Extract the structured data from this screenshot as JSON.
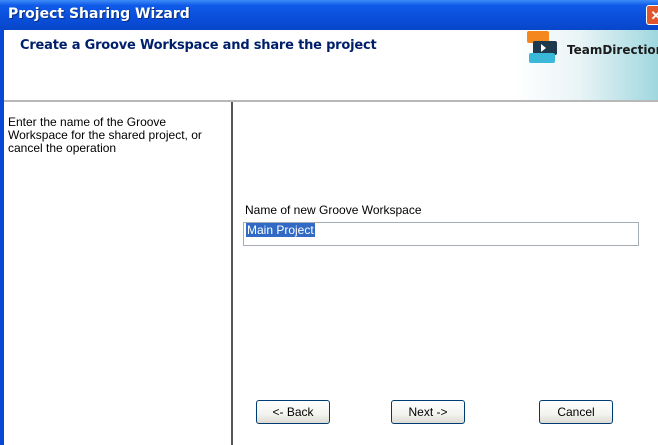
{
  "window": {
    "title": "Project Sharing Wizard",
    "close_glyph": "✕"
  },
  "header": {
    "title": "Create a Groove Workspace and share the project",
    "logo": {
      "icon": "teamdirection-logo-icon",
      "text": "TeamDirection"
    }
  },
  "left_pane": {
    "instructions": "Enter the name of the Groove Workspace for the shared project, or cancel the operation"
  },
  "form": {
    "workspace_label": "Name of new Groove Workspace",
    "workspace_value": "Main Project"
  },
  "buttons": {
    "back": "<- Back",
    "next": "Next ->",
    "cancel": "Cancel"
  },
  "colors": {
    "titlebar": "#0a4fdc",
    "header_title": "#001f6b",
    "selection": "#316ac5",
    "logo_orange": "#f4881f",
    "logo_dark": "#1e3a4c",
    "logo_cyan": "#39b8d7"
  }
}
